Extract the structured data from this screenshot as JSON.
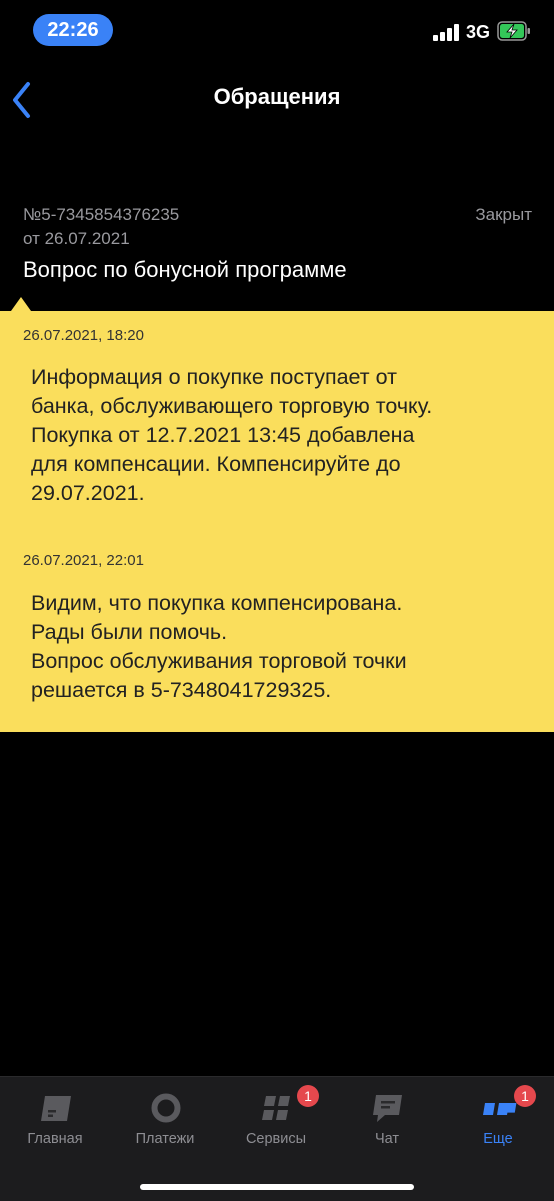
{
  "status_bar": {
    "time": "22:26",
    "network": "3G"
  },
  "header": {
    "title": "Обращения"
  },
  "ticket": {
    "number": "№5-7345854376235",
    "date": "от 26.07.2021",
    "status": "Закрыт",
    "subject": "Вопрос по бонусной программе"
  },
  "messages": [
    {
      "time": "26.07.2021, 18:20",
      "lines": [
        "Информация о покупке поступает от",
        "банка, обслуживающего торговую точку.",
        "Покупка  от 12.7.2021 13:45 добавлена",
        "для компенсации. Компенсируйте до",
        "29.07.2021."
      ]
    },
    {
      "time": "26.07.2021, 22:01",
      "lines": [
        "Видим, что покупка компенсирована.",
        "Рады были помочь.",
        "Вопрос обслуживания торговой точки",
        "решается в 5-7348041729325."
      ]
    }
  ],
  "tabs": [
    {
      "label": "Главная",
      "icon": "card-icon"
    },
    {
      "label": "Платежи",
      "icon": "circle-icon"
    },
    {
      "label": "Сервисы",
      "icon": "grid-icon",
      "badge": "1"
    },
    {
      "label": "Чат",
      "icon": "chat-icon"
    },
    {
      "label": "Еще",
      "icon": "dots-icon",
      "badge": "1",
      "active": true
    }
  ],
  "colors": {
    "accent": "#3a82f7",
    "panel": "#fade5c",
    "badge": "#e5484d"
  }
}
